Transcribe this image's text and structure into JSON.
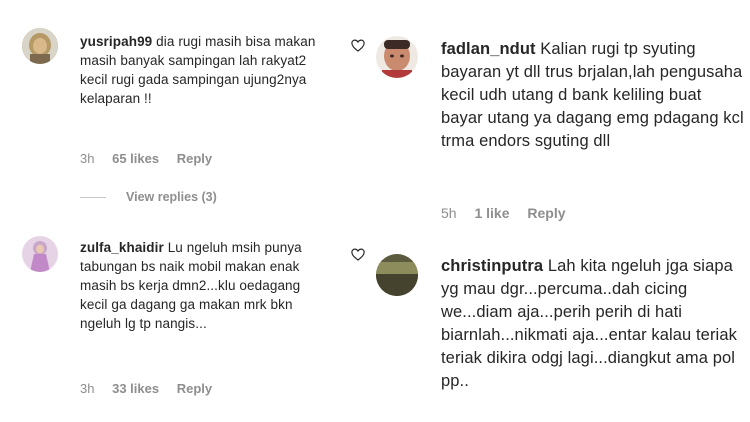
{
  "comments_left": [
    {
      "username": "yusripah99",
      "text": "dia rugi masih bisa makan masih banyak sampingan lah rakyat2 kecil rugi gada sampingan ujung2nya kelaparan !!",
      "time": "3h",
      "likes": "65 likes",
      "reply": "Reply",
      "view_replies": "View replies (3)"
    },
    {
      "username": "zulfa_khaidir",
      "text": "Lu ngeluh msih punya tabungan bs naik mobil makan enak masih bs kerja dmn2...klu oedagang kecil ga dagang ga makan mrk bkn ngeluh lg tp nangis...",
      "time": "3h",
      "likes": "33 likes",
      "reply": "Reply"
    }
  ],
  "comments_right": [
    {
      "username": "fadlan_ndut",
      "text": "Kalian rugi tp syuting bayaran yt dll trus brjalan,lah pengusaha kecil udh utang d bank keliling buat bayar utang ya dagang emg pdagang kcl trma endors sguting dll",
      "time": "5h",
      "likes": "1 like",
      "reply": "Reply"
    },
    {
      "username": "christinputra",
      "text": "Lah kita ngeluh jga siapa yg mau dgr...percuma..dah cicing we...diam aja...perih perih di hati biarnlah...nikmati aja...entar kalau teriak teriak dikira odgj lagi...diangkut ama pol pp..",
      "time": "",
      "likes": "",
      "reply": ""
    }
  ],
  "icons": {
    "like": "heart-outline-icon"
  },
  "colors": {
    "text": "#262626",
    "muted": "#8e8e8e",
    "divider": "#c7c7c7"
  }
}
